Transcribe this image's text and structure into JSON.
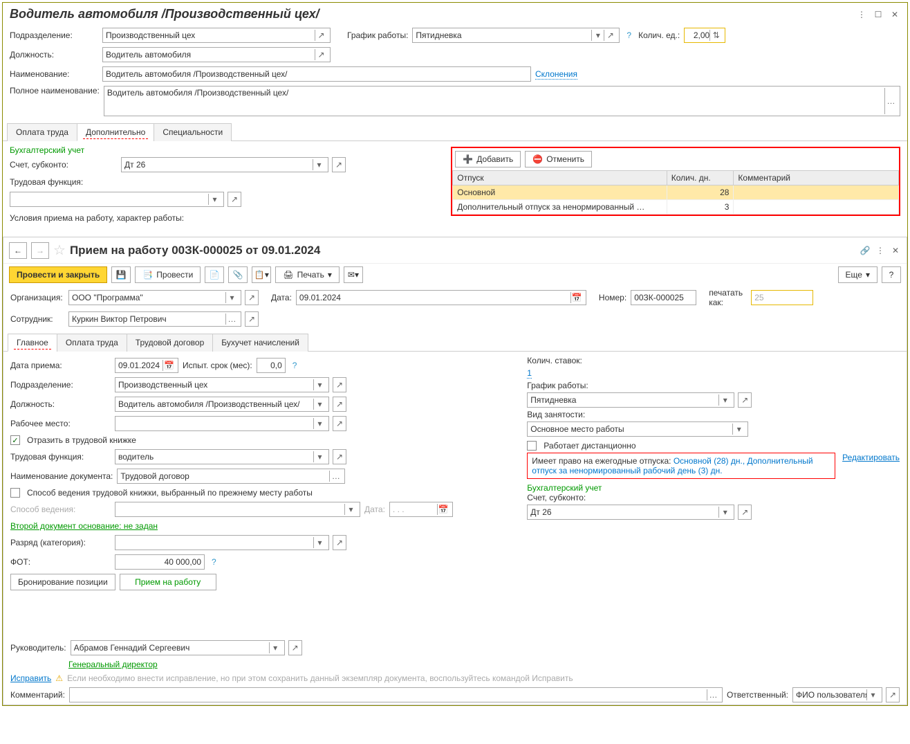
{
  "top": {
    "title": "Водитель автомобиля /Производственный цех/",
    "fields": {
      "dept_label": "Подразделение:",
      "dept_value": "Производственный цех",
      "sched_label": "График работы:",
      "sched_value": "Пятидневка",
      "qty_label": "Колич. ед.:",
      "qty_value": "2,00",
      "pos_label": "Должность:",
      "pos_value": "Водитель автомобиля",
      "name_label": "Наименование:",
      "name_value": "Водитель автомобиля /Производственный цех/",
      "decl_link": "Склонения",
      "full_label": "Полное наименование:",
      "full_value": "Водитель автомобиля /Производственный цех/"
    },
    "tabs": {
      "t1": "Оплата труда",
      "t2": "Дополнительно",
      "t3": "Специальности"
    },
    "add_panel": {
      "acct_section": "Бухгалтерский учет",
      "acct_label": "Счет, субконто:",
      "acct_value": "Дт 26",
      "func_label": "Трудовая функция:",
      "cond_label": "Условия приема на работу, характер работы:",
      "btn_add": "Добавить",
      "btn_cancel": "Отменить",
      "cols": {
        "c1": "Отпуск",
        "c2": "Колич. дн.",
        "c3": "Комментарий"
      },
      "rows": [
        {
          "name": "Основной",
          "days": "28"
        },
        {
          "name": "Дополнительный отпуск за ненормированный …",
          "days": "3"
        }
      ]
    }
  },
  "doc": {
    "title": "Прием на работу 00ЗК-000025 от 09.01.2024",
    "tb": {
      "post_close": "Провести и закрыть",
      "post": "Провести",
      "print": "Печать",
      "more": "Еще"
    },
    "head": {
      "org_label": "Организация:",
      "org_value": "ООО \"Программа\"",
      "date_label": "Дата:",
      "date_value": "09.01.2024",
      "num_label": "Номер:",
      "num_value": "00ЗК-000025",
      "print_as_label": "печатать как:",
      "print_as_ph": "25",
      "emp_label": "Сотрудник:",
      "emp_value": "Куркин Виктор Петрович"
    },
    "tabs": {
      "t1": "Главное",
      "t2": "Оплата труда",
      "t3": "Трудовой договор",
      "t4": "Бухучет начислений"
    },
    "main": {
      "hire_date_label": "Дата приема:",
      "hire_date_value": "09.01.2024",
      "trial_label": "Испыт. срок (мес):",
      "trial_value": "0,0",
      "dept_label": "Подразделение:",
      "dept_value": "Производственный цех",
      "pos_label": "Должность:",
      "pos_value": "Водитель автомобиля /Производственный цех/",
      "wp_label": "Рабочее место:",
      "record_label": "Отразить в трудовой книжке",
      "func_label": "Трудовая функция:",
      "func_value": "водитель",
      "docname_label": "Наименование документа:",
      "docname_value": "Трудовой договор",
      "method_chk": "Способ ведения трудовой книжки, выбранный по прежнему месту работы",
      "method_label": "Способ ведения:",
      "method_date_label": "Дата:",
      "second_doc": "Второй документ основание: не задан",
      "grade_label": "Разряд (категория):",
      "fot_label": "ФОТ:",
      "fot_value": "40 000,00",
      "btn_book": "Бронирование позиции",
      "btn_hire": "Прием на работу"
    },
    "right": {
      "rates_label": "Колич. ставок:",
      "rates_link": "1",
      "sched_label": "График работы:",
      "sched_value": "Пятидневка",
      "emp_type_label": "Вид занятости:",
      "emp_type_value": "Основное место работы",
      "remote_label": "Работает дистанционно",
      "vac_prefix": "Имеет право на ежегодные отпуска: ",
      "vac_link": "Основной (28) дн., Дополнительный отпуск за ненормированный рабочий день (3) дн.",
      "vac_edit": "Редактировать",
      "acct_section": "Бухгалтерский учет",
      "acct_label": "Счет, субконто:",
      "acct_value": "Дт 26"
    },
    "foot": {
      "mgr_label": "Руководитель:",
      "mgr_value": "Абрамов Геннадий Сергеевич",
      "mgr_pos": "Генеральный директор",
      "fix_link": "Исправить",
      "fix_note": "Если необходимо внести исправление, но при этом сохранить данный экземпляр документа, воспользуйтесь командой Исправить",
      "comment_label": "Комментарий:",
      "resp_label": "Ответственный:",
      "resp_value": "ФИО пользователя"
    }
  }
}
